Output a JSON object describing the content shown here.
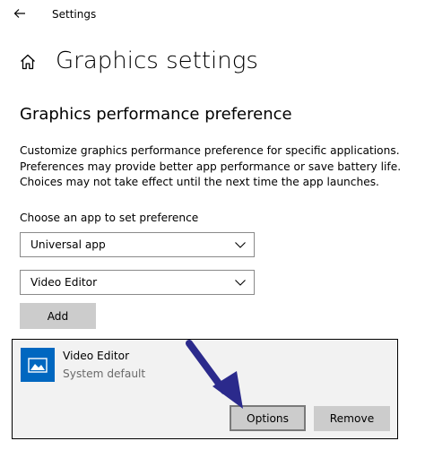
{
  "titlebar": {
    "back_icon": "back-arrow-icon",
    "app_title": "Settings"
  },
  "header": {
    "home_icon": "home-icon",
    "title": "Graphics settings"
  },
  "section": {
    "title": "Graphics performance preference",
    "description_lines": [
      "Customize graphics performance preference for specific applications.",
      "Preferences may provide better app performance or save battery life.",
      "Choices may not take effect until the next time the app launches."
    ],
    "choose_label": "Choose an app to set preference"
  },
  "app_type_dropdown": {
    "selected": "Universal app",
    "icon": "chevron-down-icon"
  },
  "app_dropdown": {
    "selected": "Video Editor",
    "icon": "chevron-down-icon"
  },
  "add_button": {
    "label": "Add"
  },
  "app_entry": {
    "name": "Video Editor",
    "preference": "System default",
    "icon": "video-editor-icon",
    "options_label": "Options",
    "remove_label": "Remove"
  },
  "annotation": {
    "icon": "annotation-arrow-icon",
    "color": "#2b2a8c"
  },
  "colors": {
    "accent": "#0067c0",
    "button_bg": "#cccccc",
    "card_bg": "#f2f2f2"
  }
}
